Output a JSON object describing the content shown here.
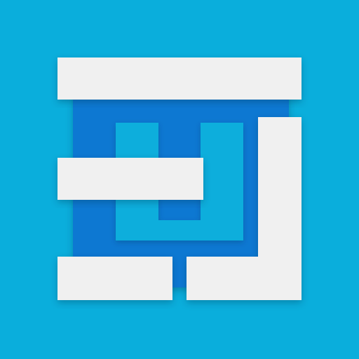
{
  "icon": {
    "name": "app-logo-icon",
    "colors": {
      "background": "#0aaedc",
      "deep_blue": "#0a78d2",
      "mid_blue": "#0aaedc",
      "white": "#f0f0f0"
    }
  }
}
